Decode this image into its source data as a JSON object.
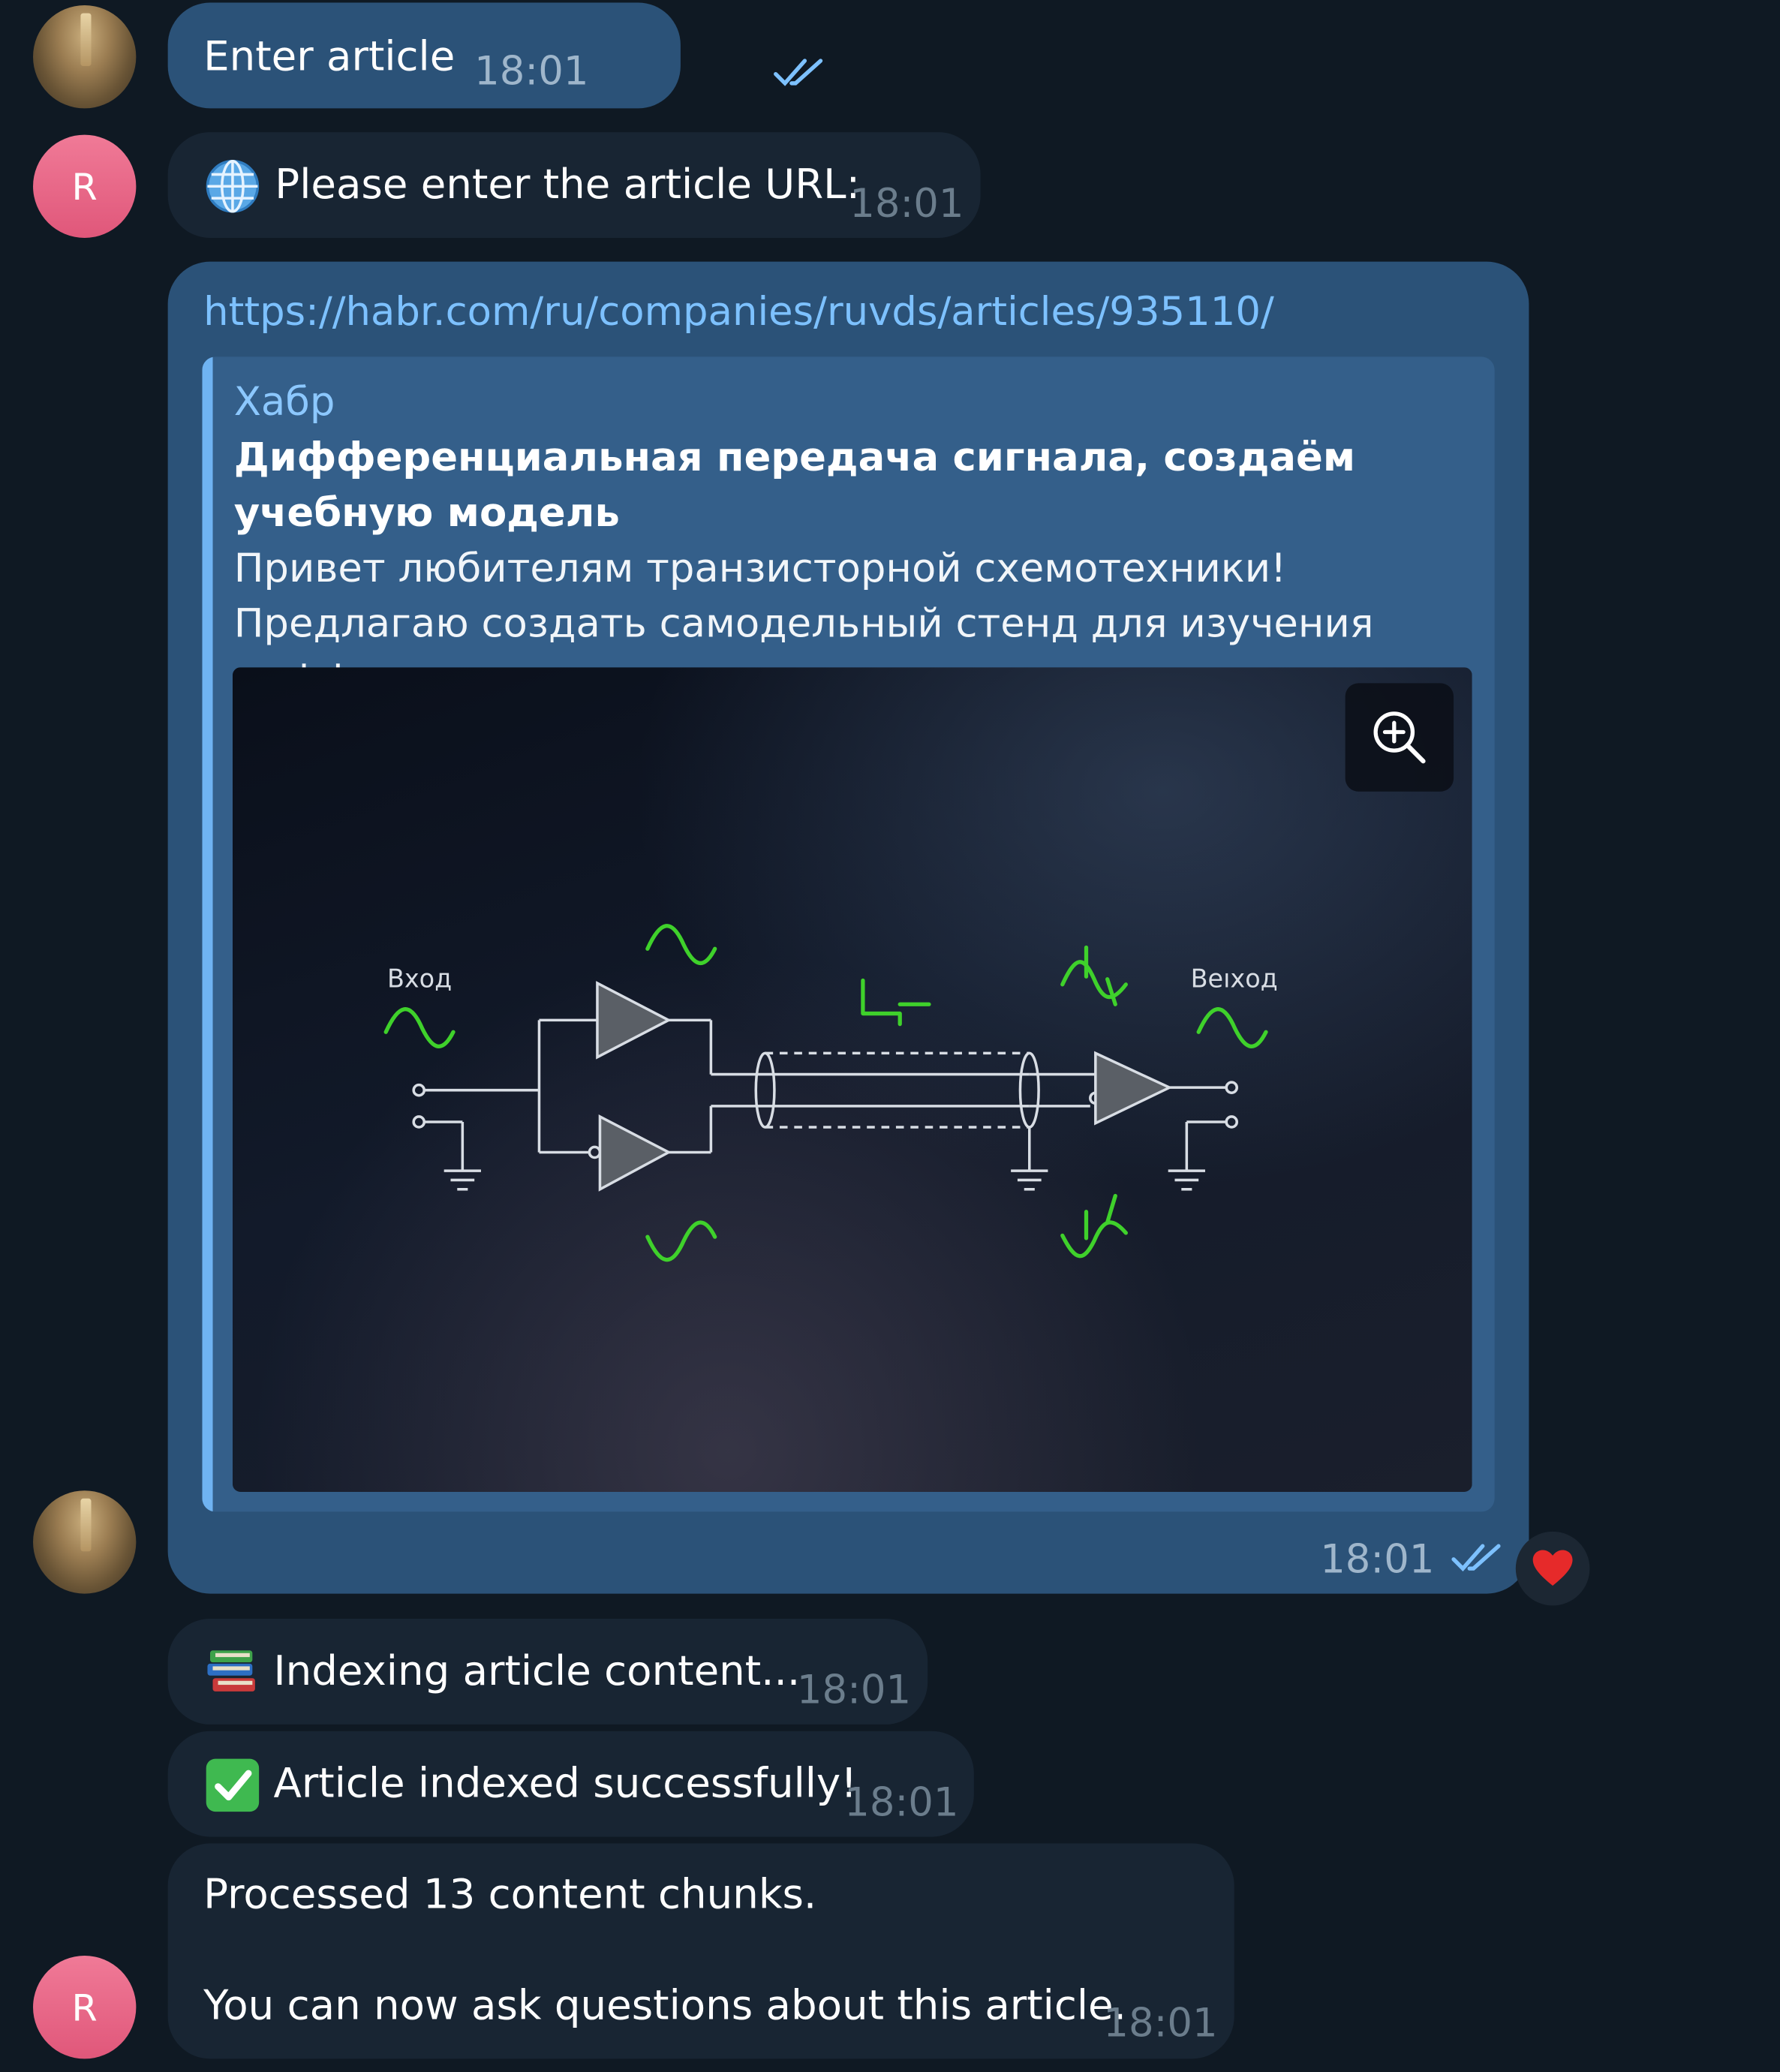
{
  "messages": {
    "m1": {
      "text": "Enter article",
      "time": "18:01"
    },
    "m2": {
      "emoji": "globe-icon",
      "text": "Please enter the article URL:",
      "time": "18:01"
    },
    "m3": {
      "url": "https://habr.com/ru/companies/ruvds/articles/935110/",
      "preview_site": "Хабр",
      "preview_title": "Дифференциальная передача сигнала, создаём учебную модель",
      "preview_description": "Привет любителям транзисторной схемотехники! Предлагаю создать самодельный стенд для изучения дифференциальн...",
      "image_label_in": "Вход",
      "image_label_out": "Веıход",
      "time": "18:01",
      "reaction": "heart"
    },
    "m4": {
      "emoji": "books-icon",
      "text": "Indexing article content...",
      "time": "18:01"
    },
    "m5": {
      "emoji": "check-icon",
      "text": "Article indexed successfully!",
      "time": "18:01"
    },
    "m6": {
      "line1": "Processed 13 content chunks.",
      "line2": "You can now ask questions about this article.",
      "time": "18:01"
    }
  },
  "avatars": {
    "bot_letter": "R"
  },
  "colors": {
    "background": "#0f1923",
    "outgoing_bubble": "#2b5278",
    "incoming_bubble": "#182533",
    "link": "#7dc1ff",
    "avatar_bot": "#e0577a"
  }
}
